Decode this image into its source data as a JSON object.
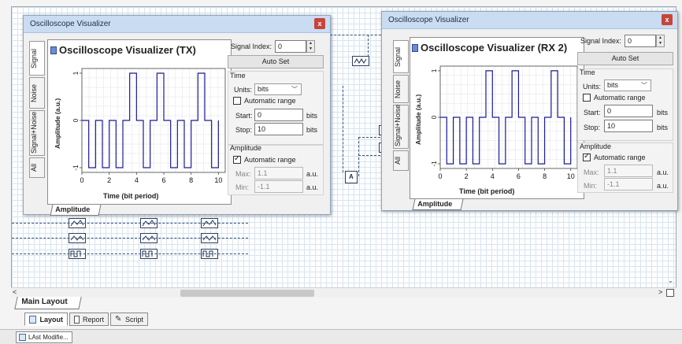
{
  "windows": [
    {
      "title": "Oscilloscope Visualizer",
      "plot_title": "Oscilloscope Visualizer (TX)",
      "tabs": [
        "Signal",
        "Noise",
        "Signal+Noise",
        "All"
      ],
      "y_axis_label": "Amplitude (a.u.)",
      "x_axis_label": "Time (bit period)",
      "x_ticks": [
        "0",
        "2",
        "4",
        "6",
        "8",
        "10"
      ],
      "y_ticks": [
        "1",
        "0",
        "-1"
      ],
      "bottom_tab": "Amplitude",
      "controls": {
        "signal_index_label": "Signal Index:",
        "signal_index": "0",
        "auto_set": "Auto Set",
        "time_group": "Time",
        "units_label": "Units:",
        "units_value": "bits",
        "auto_range_time": "Automatic range",
        "start_label": "Start:",
        "start_value": "0",
        "stop_label": "Stop:",
        "stop_value": "10",
        "time_unit": "bits",
        "amplitude_group": "Amplitude",
        "auto_range_amp": "Automatic range",
        "max_label": "Max:",
        "max_value": "1.1",
        "min_label": "Min:",
        "min_value": "-1.1",
        "amp_unit": "a.u."
      }
    },
    {
      "title": "Oscilloscope Visualizer",
      "plot_title": "Oscilloscope Visualizer  (RX 2)",
      "tabs": [
        "Signal",
        "Noise",
        "Signal+Noise",
        "All"
      ],
      "y_axis_label": "Amplitude (a.u.)",
      "x_axis_label": "Time (bit period)",
      "x_ticks": [
        "0",
        "2",
        "4",
        "6",
        "8",
        "10"
      ],
      "y_ticks": [
        "1",
        "0",
        "-1"
      ],
      "bottom_tab": "Amplitude",
      "controls": {
        "signal_index_label": "Signal Index:",
        "signal_index": "0",
        "auto_set": "Auto Set",
        "time_group": "Time",
        "units_label": "Units:",
        "units_value": "bits",
        "auto_range_time": "Automatic range",
        "start_label": "Start:",
        "start_value": "0",
        "stop_label": "Stop:",
        "stop_value": "10",
        "time_unit": "bits",
        "amplitude_group": "Amplitude",
        "auto_range_amp": "Automatic range",
        "max_label": "Max:",
        "max_value": "1.1",
        "min_label": "Min:",
        "min_value": "-1.1",
        "amp_unit": "a.u."
      }
    }
  ],
  "chart_data": {
    "type": "line",
    "x": [
      0,
      0.5,
      1,
      1.5,
      2,
      2.5,
      3,
      3.5,
      4,
      4.5,
      5,
      5.5,
      6,
      6.5,
      7,
      7.5,
      8,
      8.5,
      9,
      9.5,
      10
    ],
    "y": [
      0,
      -1,
      0,
      -1,
      0,
      -1,
      0,
      1,
      0,
      -1,
      0,
      1,
      0,
      -1,
      0,
      -1,
      0,
      1,
      0,
      -1,
      0
    ],
    "pulse_width": 0.5,
    "xlim": [
      0,
      10.5
    ],
    "ylim": [
      -1.1,
      1.1
    ],
    "xlabel": "Time (bit period)",
    "ylabel": "Amplitude (a.u.)",
    "grid": true
  },
  "main": {
    "layout_tab": "Main Layout"
  },
  "bottom_tabs": [
    "Layout",
    "Report",
    "Script"
  ],
  "taskbar": {
    "item": "LAst Modifie..."
  }
}
